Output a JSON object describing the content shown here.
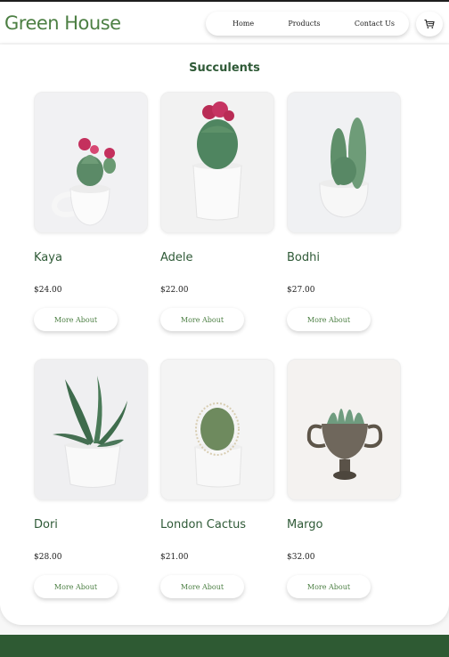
{
  "brand": "Green House",
  "nav": {
    "home": "Home",
    "products": "Products",
    "contact": "Contact Us"
  },
  "icons": {
    "cart": "cart-icon"
  },
  "section": {
    "title": "Succulents"
  },
  "button_label": "More About",
  "colors": {
    "brand_green": "#4c7f43",
    "title_green": "#2f5a37",
    "footer_green": "#2e5a33"
  },
  "products": [
    {
      "name": "Kaya",
      "price": "$24.00",
      "button": "More About"
    },
    {
      "name": "Adele",
      "price": "$22.00",
      "button": "More About"
    },
    {
      "name": "Bodhi",
      "price": "$27.00",
      "button": "More About"
    },
    {
      "name": "Dori",
      "price": "$28.00",
      "button": "More About"
    },
    {
      "name": "London Cactus",
      "price": "$21.00",
      "button": "More About"
    },
    {
      "name": "Margo",
      "price": "$32.00",
      "button": "More About"
    }
  ]
}
